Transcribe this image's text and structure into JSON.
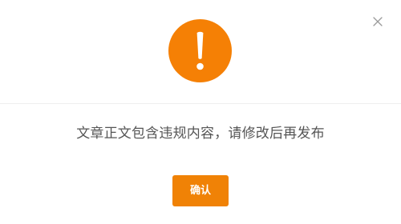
{
  "dialog": {
    "message": "文章正文包含违规内容，请修改后再发布",
    "confirm_label": "确认",
    "close_icon": "close-icon",
    "warning_icon": "exclamation-icon"
  },
  "colors": {
    "accent": "#f58005",
    "button": "#f08206",
    "text": "#555555",
    "close": "#9a9a9a"
  }
}
